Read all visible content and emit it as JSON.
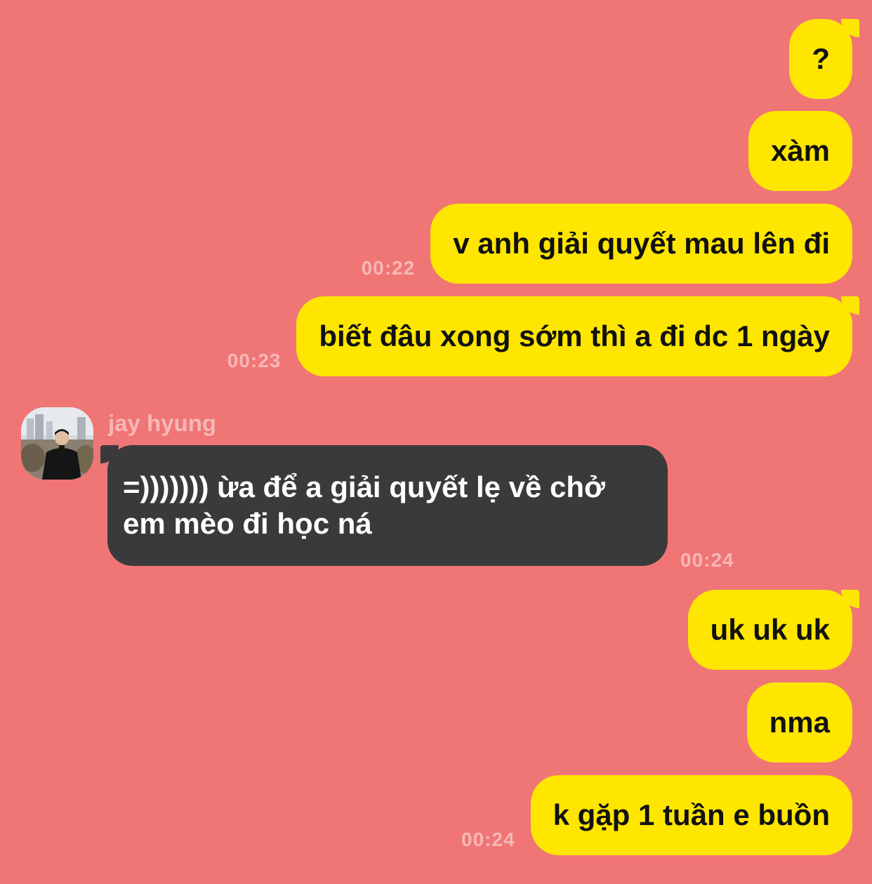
{
  "colors": {
    "background": "#f07575",
    "outgoing_bubble": "#ffe600",
    "incoming_bubble": "#3a3a3c",
    "timestamp": "#f6b8b6"
  },
  "messages": [
    {
      "direction": "out",
      "text": "?",
      "time": ""
    },
    {
      "direction": "out",
      "text": "xàm",
      "time": ""
    },
    {
      "direction": "out",
      "text": "v anh giải quyết mau lên đi",
      "time": "00:22"
    },
    {
      "direction": "out",
      "text": "biết đâu xong sớm thì a đi dc 1 ngày",
      "time": "00:23"
    },
    {
      "direction": "in",
      "sender": "jay hyung",
      "avatar_icon": "user-photo-icon",
      "text": "=))))))) ừa để a giải quyết lẹ về chở em mèo đi học ná",
      "time": "00:24"
    },
    {
      "direction": "out",
      "text": "uk uk uk",
      "time": ""
    },
    {
      "direction": "out",
      "text": "nma",
      "time": ""
    },
    {
      "direction": "out",
      "text": "k gặp 1 tuần e buồn",
      "time": "00:24"
    }
  ]
}
